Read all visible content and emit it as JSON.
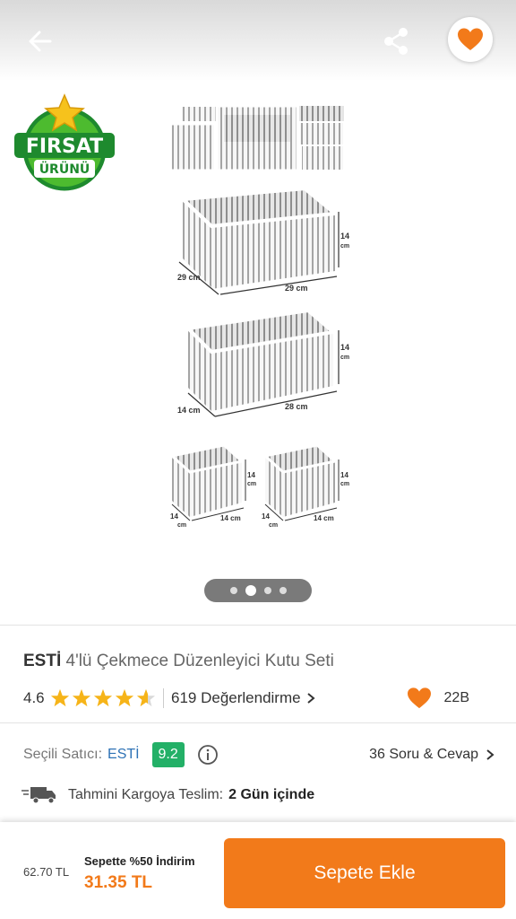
{
  "header": {
    "back_icon": "arrow-left-icon",
    "share_icon": "share-icon",
    "favorite_icon": "heart-icon",
    "favorite_color": "#f27a1a"
  },
  "gallery": {
    "badge_line1": "FIRSAT",
    "badge_line2": "ÜRÜNÜ",
    "image_labels": {
      "w29a": "29 cm",
      "w29b": "29 cm",
      "h14a": "14",
      "cm_a": "cm",
      "w14b": "14 cm",
      "w28": "28 cm",
      "h14b": "14",
      "cm_b": "cm",
      "s1w": "14 cm",
      "s1d": "14",
      "s1h": "14",
      "s1cm": "cm",
      "s1cm2": "cm",
      "s2w": "14 cm",
      "s2d": "14",
      "s2h": "14",
      "s2cm": "cm",
      "s2cm2": "cm"
    },
    "page_count": 4,
    "active_page": 2
  },
  "product": {
    "brand": "ESTİ",
    "name": "4'lü Çekmece Düzenleyici Kutu Seti",
    "rating": "4.6",
    "rating_value": 4.6,
    "reviews": "619 Değerlendirme",
    "likes": "22B"
  },
  "seller": {
    "label": "Seçili Satıcı:",
    "name": "ESTİ",
    "score": "9.2",
    "qa": "36 Soru & Cevap"
  },
  "shipping": {
    "label": "Tahmini Kargoya Teslim:",
    "value": "2 Gün içinde"
  },
  "footer": {
    "old_price": "62.70 TL",
    "promo": "Sepette %50 İndirim",
    "new_price": "31.35 TL",
    "add_to_cart": "Sepete Ekle"
  },
  "colors": {
    "accent": "#f27a1a",
    "seller_link": "#2f73b6",
    "score_badge": "#23b067"
  }
}
